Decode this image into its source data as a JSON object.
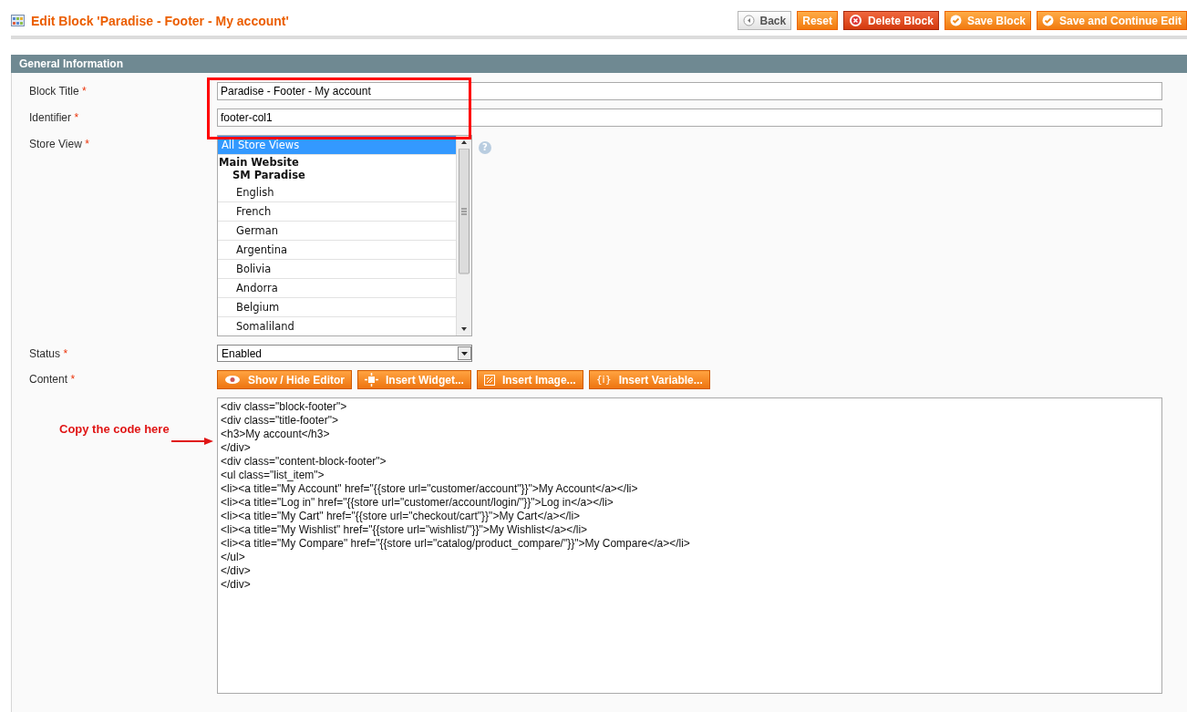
{
  "page_title": "Edit Block 'Paradise - Footer - My account'",
  "actions": [
    {
      "label": "Back",
      "kind": "back"
    },
    {
      "label": "Reset",
      "kind": "plain"
    },
    {
      "label": "Delete Block",
      "kind": "delete"
    },
    {
      "label": "Save Block",
      "kind": "save"
    },
    {
      "label": "Save and Continue Edit",
      "kind": "save"
    }
  ],
  "section": {
    "title": "General Information"
  },
  "fields": {
    "block_title": {
      "label": "Block Title",
      "required_mark": "*",
      "value": "Paradise - Footer - My account"
    },
    "identifier": {
      "label": "Identifier",
      "required_mark": "*",
      "value": "footer-col1"
    },
    "store_view": {
      "label": "Store View",
      "required_mark": "*",
      "help": "?",
      "options": [
        {
          "label": "All Store Views",
          "kind": "option",
          "selected": true
        },
        {
          "label": "Main Website",
          "kind": "website",
          "selected": false
        },
        {
          "label": "SM Paradise",
          "kind": "store",
          "selected": false
        },
        {
          "label": "English",
          "kind": "option",
          "selected": false
        },
        {
          "label": "French",
          "kind": "option",
          "selected": false
        },
        {
          "label": "German",
          "kind": "option",
          "selected": false
        },
        {
          "label": "Argentina",
          "kind": "option",
          "selected": false
        },
        {
          "label": "Bolivia",
          "kind": "option",
          "selected": false
        },
        {
          "label": "Andorra",
          "kind": "option",
          "selected": false
        },
        {
          "label": "Belgium",
          "kind": "option",
          "selected": false
        },
        {
          "label": "Somaliland",
          "kind": "option",
          "selected": false
        }
      ]
    },
    "status": {
      "label": "Status",
      "required_mark": "*",
      "value": "Enabled"
    },
    "content": {
      "label": "Content",
      "required_mark": "*",
      "tools": [
        {
          "label": "Show / Hide Editor",
          "kind": "editor"
        },
        {
          "label": "Insert Widget...",
          "kind": "widget"
        },
        {
          "label": "Insert Image...",
          "kind": "image"
        },
        {
          "label": "Insert Variable...",
          "kind": "variable",
          "icon_text": "{i}"
        }
      ],
      "code_lines": [
        "<div class=\"block-footer\">",
        "<div class=\"title-footer\">",
        "<h3>My account</h3>",
        "</div>",
        "<div class=\"content-block-footer\">",
        "<ul class=\"list_item\">",
        "<li><a title=\"My Account\" href=\"{{store url=\"customer/account\"}}\">My Account</a></li>",
        "<li><a title=\"Log in\" href=\"{{store url=\"customer/account/login/\"}}\">Log in</a></li>",
        "<li><a title=\"My Cart\" href=\"{{store url=\"checkout/cart\"}}\">My Cart</a></li>",
        "<li><a title=\"My Wishlist\" href=\"{{store url=\"wishlist/\"}}\">My Wishlist</a></li>",
        "<li><a title=\"My Compare\" href=\"{{store url=\"catalog/product_compare/\"}}\">My Compare</a></li>",
        "</ul>",
        "</div>",
        "</div>"
      ]
    }
  },
  "annotation": {
    "text": "Copy the code here"
  }
}
